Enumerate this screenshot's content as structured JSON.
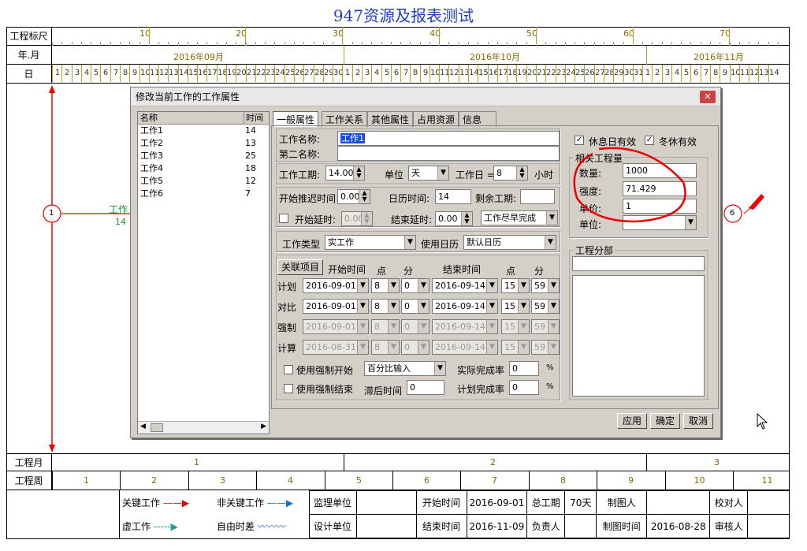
{
  "title": "947资源及报表测试",
  "ruler": {
    "label": "工程标尺",
    "ticks": [
      "10",
      "20",
      "30",
      "40",
      "50",
      "60",
      "70"
    ]
  },
  "months_row": {
    "label": "年.月",
    "months": [
      "2016年09月",
      "2016年10月",
      "2016年11月"
    ]
  },
  "day_row": {
    "label": "日",
    "days": [
      "1",
      "2",
      "3",
      "4",
      "5",
      "6",
      "7",
      "8",
      "9",
      "10",
      "11",
      "12",
      "13",
      "14",
      "15",
      "16",
      "17",
      "18",
      "19",
      "20",
      "21",
      "22",
      "23",
      "24",
      "25",
      "26",
      "27",
      "28",
      "29",
      "30",
      "1",
      "2",
      "3",
      "4",
      "5",
      "6",
      "7",
      "8",
      "9",
      "10",
      "11",
      "12",
      "13",
      "14",
      "15",
      "16",
      "17",
      "18",
      "19",
      "20",
      "21",
      "22",
      "23",
      "24",
      "25",
      "26",
      "27",
      "28",
      "29",
      "30",
      "31",
      "1",
      "2",
      "3",
      "4",
      "5",
      "6",
      "7",
      "8",
      "9",
      "10",
      "11",
      "12",
      "13",
      "14"
    ]
  },
  "network": {
    "node_start": "1",
    "node_end": "6",
    "task_label": "工作",
    "task_duration": "14"
  },
  "project_month_row": {
    "label": "工程月",
    "values": [
      "1",
      "2",
      "3"
    ]
  },
  "project_week_row": {
    "label": "工程周",
    "values": [
      "1",
      "2",
      "3",
      "4",
      "5",
      "6",
      "7",
      "8",
      "9",
      "10",
      "11"
    ]
  },
  "legend": {
    "critical": "关键工作",
    "noncritical": "非关键工作",
    "virtual": "虚工作",
    "free_float": "自由时差"
  },
  "footer": {
    "supervision_unit": "监理单位",
    "design_unit": "设计单位",
    "start_time_label": "开始时间",
    "start_time": "2016-09-01",
    "end_time_label": "结束时间",
    "end_time": "2016-11-09",
    "total_duration_label": "总工期",
    "total_duration": "70天",
    "owner_label": "负责人",
    "drawer_label": "制图人",
    "draw_time_label": "制图时间",
    "draw_time": "2016-08-28",
    "proofreader_label": "校对人",
    "reviewer_label": "审核人"
  },
  "dialog": {
    "title": "修改当前工作的工作属性",
    "close_icon": "close-icon",
    "list": {
      "headers": [
        "名称",
        "时间"
      ],
      "rows": [
        {
          "name": "工作1",
          "time": "14"
        },
        {
          "name": "工作2",
          "time": "13"
        },
        {
          "name": "工作3",
          "time": "25"
        },
        {
          "name": "工作4",
          "time": "18"
        },
        {
          "name": "工作5",
          "time": "12"
        },
        {
          "name": "工作6",
          "time": "7"
        }
      ]
    },
    "tabs": [
      "一般属性",
      "工作关系",
      "其他属性",
      "占用资源",
      "信息"
    ],
    "work_name_label": "工作名称:",
    "work_name": "工作1",
    "second_name_label": "第二名称:",
    "second_name": "",
    "duration_label": "工作工期:",
    "duration": "14.00",
    "unit_label": "单位",
    "unit": "天",
    "workday_label": "工作日 =",
    "workday": "8",
    "hours_label": "小时",
    "start_delay_label": "开始推迟时间",
    "start_delay": "0.00",
    "calendar_time_label": "日历时间:",
    "calendar_time": "14",
    "remaining_label": "剩余工期:",
    "remaining": "",
    "start_lag_label": "开始延时:",
    "start_lag": "0.00",
    "end_lag_label": "结束延时:",
    "end_lag": "0.00",
    "complete_mode": "工作尽早完成",
    "work_type_label": "工作类型",
    "work_type": "实工作",
    "calendar_label": "使用日历",
    "calendar": "默认日历",
    "link_button": "关联项目",
    "start_time_col": "开始时间",
    "point_col": "点",
    "minute_col": "分",
    "end_time_col": "结束时间",
    "schedule": [
      {
        "label": "计划",
        "start": "2016-09-01",
        "sh": "8",
        "sm": "0",
        "end": "2016-09-14",
        "eh": "15",
        "em": "59",
        "disabled": false
      },
      {
        "label": "对比",
        "start": "2016-09-01",
        "sh": "8",
        "sm": "0",
        "end": "2016-09-14",
        "eh": "15",
        "em": "59",
        "disabled": false
      },
      {
        "label": "强制",
        "start": "2016-09-01",
        "sh": "8",
        "sm": "0",
        "end": "2016-09-14",
        "eh": "15",
        "em": "59",
        "disabled": true
      },
      {
        "label": "计算",
        "start": "2016-08-31",
        "sh": "8",
        "sm": "0",
        "end": "2016-09-14",
        "eh": "15",
        "em": "59",
        "disabled": true
      }
    ],
    "force_start_label": "使用强制开始",
    "force_end_label": "使用强制结束",
    "percent_input": "百分比输入",
    "lag_time_label": "滞后时间",
    "lag_time": "0",
    "actual_rate_label": "实际完成率",
    "actual_rate": "0",
    "plan_rate_label": "计划完成率",
    "plan_rate": "0",
    "percent_sign": "%",
    "rest_day_label": "休息日有效",
    "winter_label": "冬休有效",
    "quantity_group": "相关工程量",
    "quantity_label": "数量:",
    "quantity": "1000",
    "intensity_label": "强度:",
    "intensity": "71.429",
    "unit_price_label": "单价:",
    "unit_price": "1",
    "unit2_label": "单位:",
    "unit2": "",
    "division_label": "工程分部",
    "division": "",
    "apply_button": "应用",
    "ok_button": "确定",
    "cancel_button": "取消"
  }
}
